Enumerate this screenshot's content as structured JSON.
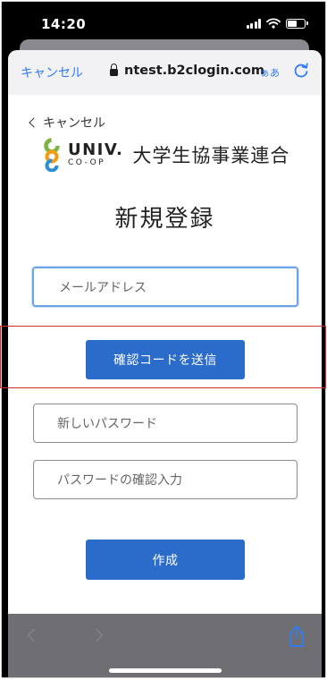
{
  "status_bar": {
    "time": "14:20"
  },
  "browser": {
    "cancel_label": "キャンセル",
    "url": "ntest.b2clogin.com",
    "text_size_label": "ぁあ"
  },
  "page": {
    "back_label": "キャンセル",
    "logo": {
      "univ": "UNIV.",
      "coop": "CO-OP",
      "org_name": "大学生協事業連合"
    },
    "title": "新規登録",
    "email_placeholder": "メールアドレス",
    "send_code_label": "確認コードを送信",
    "new_password_placeholder": "新しいパスワード",
    "confirm_password_placeholder": "パスワードの確認入力",
    "create_label": "作成"
  },
  "colors": {
    "link_blue": "#2f7cf6",
    "button_blue": "#2b6ccb",
    "highlight_red": "#d32f2f",
    "logo_green": "#7cb342",
    "logo_orange": "#f39c12"
  }
}
